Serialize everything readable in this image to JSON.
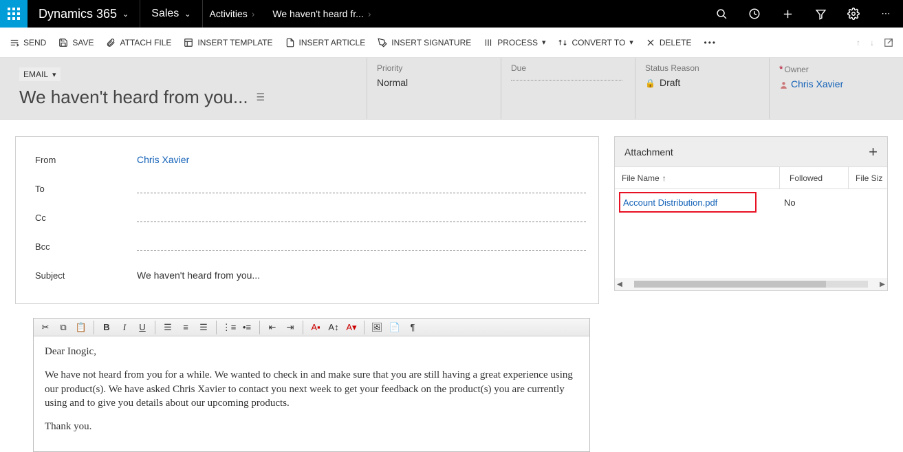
{
  "topnav": {
    "brand": "Dynamics 365",
    "area": "Sales",
    "crumb1": "Activities",
    "crumb2": "We haven't heard fr..."
  },
  "cmd": {
    "send": "SEND",
    "save": "SAVE",
    "attach": "ATTACH FILE",
    "insert_template": "INSERT TEMPLATE",
    "insert_article": "INSERT ARTICLE",
    "insert_signature": "INSERT SIGNATURE",
    "process": "PROCESS",
    "convert": "CONVERT TO",
    "delete": "DELETE"
  },
  "header": {
    "entity": "EMAIL",
    "title": "We haven't heard from you...",
    "priority_lbl": "Priority",
    "priority_val": "Normal",
    "due_lbl": "Due",
    "status_lbl": "Status Reason",
    "status_val": "Draft",
    "owner_lbl": "Owner",
    "owner_val": "Chris Xavier"
  },
  "form": {
    "from_lbl": "From",
    "from_val": "Chris Xavier",
    "to_lbl": "To",
    "cc_lbl": "Cc",
    "bcc_lbl": "Bcc",
    "subject_lbl": "Subject",
    "subject_val": "We haven't heard from you..."
  },
  "attach": {
    "title": "Attachment",
    "col_filename": "File Name",
    "col_followed": "Followed",
    "col_filesize": "File Siz",
    "rows": [
      {
        "name": "Account Distribution.pdf",
        "followed": "No"
      }
    ]
  },
  "body": {
    "p1": "Dear Inogic,",
    "p2": "We have not heard from you for a while. We wanted to check in and make sure that you are still having a great experience using our product(s). We have asked Chris Xavier to contact you next week to get your feedback on the product(s) you are currently using and to give you details about our upcoming products.",
    "p3": "Thank you."
  }
}
